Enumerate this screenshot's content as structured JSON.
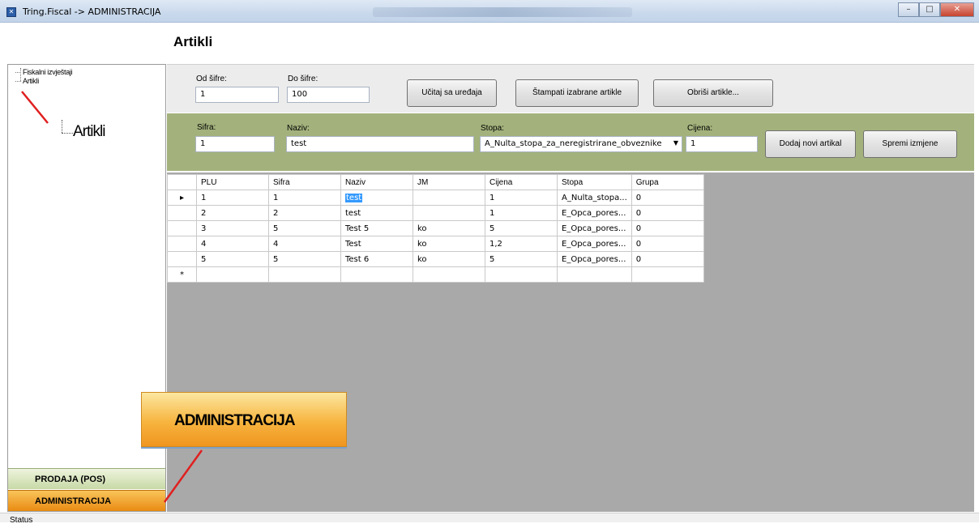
{
  "window": {
    "title": "Tring.Fiscal -> ADMINISTRACIJA"
  },
  "page": {
    "title": "Artikli"
  },
  "tree": {
    "items": [
      "Fiskalni izvještaji",
      "Artikli"
    ],
    "zoom_label": "Artikli"
  },
  "nav": {
    "prodaja": "PRODAJA (POS)",
    "administracija": "ADMINISTRACIJA"
  },
  "callout": {
    "label": "ADMINISTRACIJA"
  },
  "filter": {
    "od_label": "Od šifre:",
    "od_value": "1",
    "do_label": "Do šifre:",
    "do_value": "100",
    "load_button": "Učitaj sa uređaja",
    "print_button": "Štampati izabrane artikle",
    "delete_button": "Obriši artikle..."
  },
  "edit": {
    "sifra_label": "Sifra:",
    "sifra_value": "1",
    "naziv_label": "Naziv:",
    "naziv_value": "test",
    "stopa_label": "Stopa:",
    "stopa_value": "A_Nulta_stopa_za_neregistrirane_obveznike",
    "cijena_label": "Cijena:",
    "cijena_value": "1",
    "add_button": "Dodaj novi artikal",
    "save_button": "Spremi izmjene"
  },
  "grid": {
    "columns": [
      "PLU",
      "Sifra",
      "Naziv",
      "JM",
      "Cijena",
      "Stopa",
      "Grupa"
    ],
    "rows": [
      {
        "plu": "1",
        "sifra": "1",
        "naziv": "test",
        "jm": "",
        "cijena": "1",
        "stopa": "A_Nulta_stopa...",
        "grupa": "0"
      },
      {
        "plu": "2",
        "sifra": "2",
        "naziv": "test",
        "jm": "",
        "cijena": "1",
        "stopa": "E_Opca_pores...",
        "grupa": "0"
      },
      {
        "plu": "3",
        "sifra": "5",
        "naziv": "Test 5",
        "jm": "ko",
        "cijena": "5",
        "stopa": "E_Opca_pores...",
        "grupa": "0"
      },
      {
        "plu": "4",
        "sifra": "4",
        "naziv": "Test",
        "jm": "ko",
        "cijena": "1,2",
        "stopa": "E_Opca_pores...",
        "grupa": "0"
      },
      {
        "plu": "5",
        "sifra": "5",
        "naziv": "Test 6",
        "jm": "ko",
        "cijena": "5",
        "stopa": "E_Opca_pores...",
        "grupa": "0"
      }
    ],
    "current_row_marker": "▸",
    "new_row_marker": "*"
  },
  "status": {
    "text": "Status"
  },
  "colors": {
    "edit_panel": "#a3b27c",
    "nav_admin": "#f0a030",
    "nav_prodaja": "#d4e2b6",
    "grid_bg": "#a9a9a9",
    "annotation": "#e02020"
  }
}
